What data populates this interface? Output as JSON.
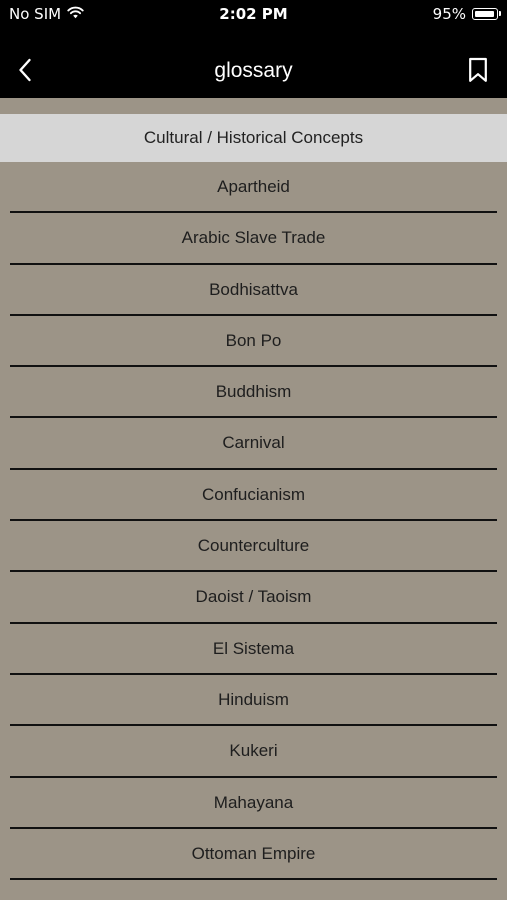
{
  "status_bar": {
    "carrier": "No SIM",
    "time": "2:02 PM",
    "battery_pct": "95%",
    "battery_level": 0.95,
    "wifi_icon": "wifi-icon",
    "battery_icon": "battery-icon"
  },
  "nav": {
    "title": "glossary",
    "back_icon": "chevron-left-icon",
    "bookmark_icon": "bookmark-icon"
  },
  "section": {
    "header": "Cultural / Historical Concepts"
  },
  "items": [
    {
      "label": "Apartheid"
    },
    {
      "label": "Arabic Slave Trade"
    },
    {
      "label": "Bodhisattva"
    },
    {
      "label": "Bon Po"
    },
    {
      "label": "Buddhism"
    },
    {
      "label": "Carnival"
    },
    {
      "label": "Confucianism"
    },
    {
      "label": "Counterculture"
    },
    {
      "label": "Daoist / Taoism"
    },
    {
      "label": "El Sistema"
    },
    {
      "label": "Hinduism"
    },
    {
      "label": "Kukeri"
    },
    {
      "label": "Mahayana"
    },
    {
      "label": "Ottoman Empire"
    }
  ],
  "colors": {
    "bar_background": "#000000",
    "list_background": "#9c9487",
    "section_header_background": "#d6d6d6",
    "divider": "#111111"
  }
}
